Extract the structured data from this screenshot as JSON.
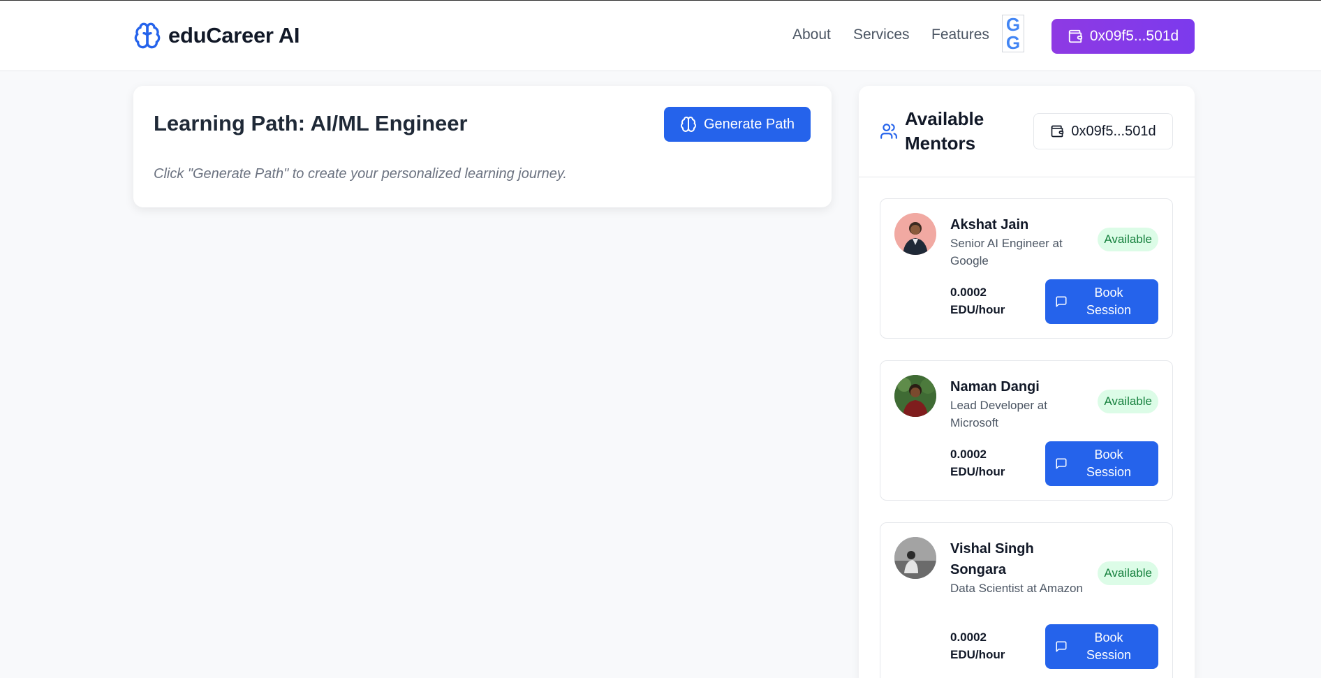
{
  "header": {
    "brand": "eduCareer AI",
    "nav": [
      "About",
      "Services",
      "Features"
    ],
    "google_letter": "G",
    "wallet_address": "0x09f5...501d"
  },
  "learning_path": {
    "title": "Learning Path: AI/ML Engineer",
    "generate_label": "Generate Path",
    "hint": "Click \"Generate Path\" to create your personalized learning journey."
  },
  "mentors": {
    "title": "Available Mentors",
    "wallet_address": "0x09f5...501d",
    "book_label": "Book Session",
    "items": [
      {
        "name": "Akshat Jain",
        "role": "Senior AI Engineer at Google",
        "status": "Available",
        "price": "0.0002 EDU/hour"
      },
      {
        "name": "Naman Dangi",
        "role": "Lead Developer at Microsoft",
        "status": "Available",
        "price": "0.0002 EDU/hour"
      },
      {
        "name": "Vishal Singh Songara",
        "role": "Data Scientist at Amazon",
        "status": "Available",
        "price": "0.0002 EDU/hour"
      }
    ]
  },
  "colors": {
    "primary": "#2563eb",
    "wallet_purple": "#7c3aed",
    "available_bg": "#dcfce7",
    "available_text": "#15803d"
  }
}
